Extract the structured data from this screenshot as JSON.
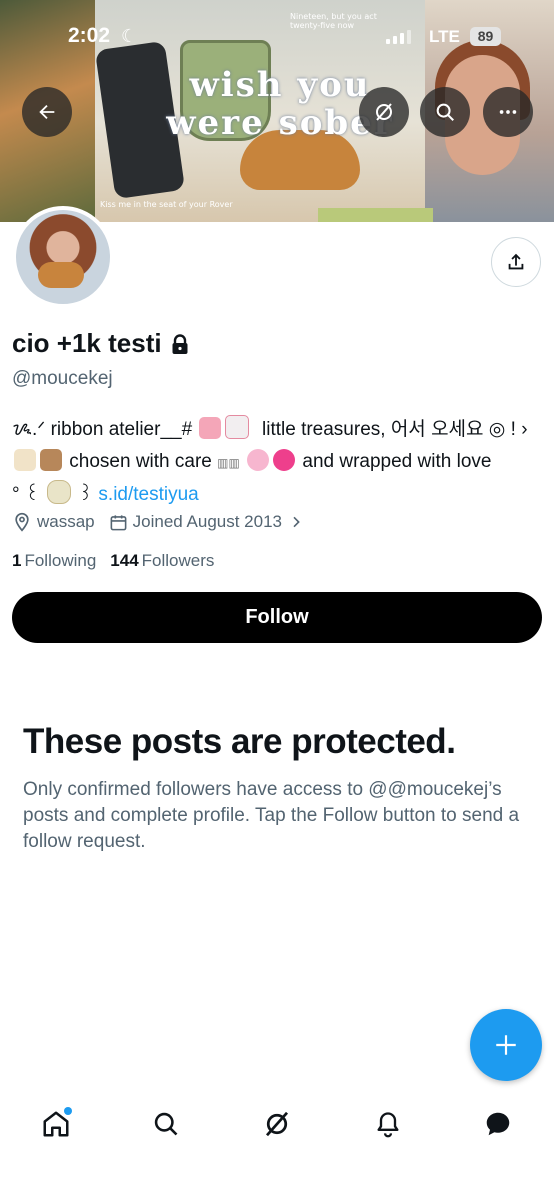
{
  "status_bar": {
    "time": "2:02",
    "network": "LTE",
    "battery": "89"
  },
  "banner": {
    "headline": "wish you were sober",
    "note_top": "Nineteen, but you act twenty-five now",
    "note_bottom": "Kiss me in the seat of your Rover"
  },
  "profile": {
    "name": "cio +1k testi",
    "handle": "@moucekej",
    "bio_line1_a": "ᝰ.ᐟ ribbon atelier__#",
    "bio_line1_b": "little treasures, 어서 오세요 ◎ ! ›",
    "bio_line2_a": "chosen with care",
    "bio_line2_b": "and wrapped with love",
    "bio_line3_a": "° ꒰",
    "bio_line3_b": "꒱",
    "bio_link": "s.id/testiyua",
    "location": "wassap",
    "joined": "Joined August 2013",
    "following_count": "1",
    "following_label": "Following",
    "followers_count": "144",
    "followers_label": "Followers"
  },
  "actions": {
    "follow_label": "Follow"
  },
  "protected": {
    "title": "These posts are protected.",
    "description": "Only confirmed followers have access to @@moucekej’s posts and complete profile. Tap the Follow button to send a follow request."
  },
  "colors": {
    "accent": "#1d9bf0",
    "text": "#0f1419",
    "muted": "#536471",
    "button": "#000000"
  },
  "icons": {
    "back": "arrow-left-icon",
    "grok": "grok-icon",
    "search": "search-icon",
    "more": "more-icon",
    "share": "share-icon",
    "lock": "lock-icon",
    "location": "location-pin-icon",
    "calendar": "calendar-icon",
    "compose": "plus-icon",
    "home": "home-icon",
    "notifications": "bell-icon",
    "messages": "chat-icon"
  }
}
